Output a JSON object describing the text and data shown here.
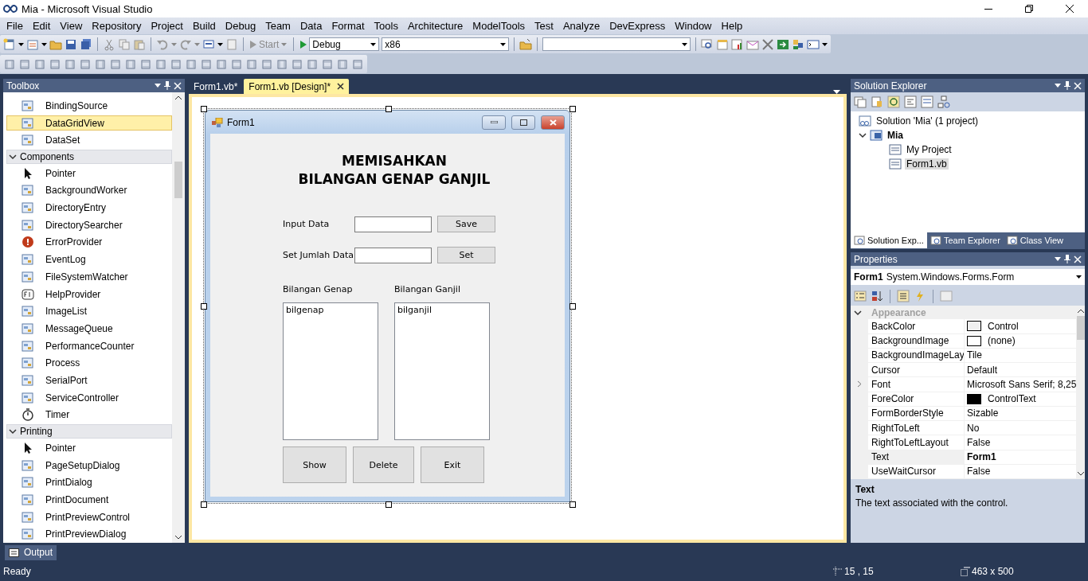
{
  "window": {
    "title": "Mia - Microsoft Visual Studio"
  },
  "menu": [
    "File",
    "Edit",
    "View",
    "Repository",
    "Project",
    "Build",
    "Debug",
    "Team",
    "Data",
    "Format",
    "Tools",
    "Architecture",
    "ModelTools",
    "Test",
    "Analyze",
    "DevExpress",
    "Window",
    "Help"
  ],
  "toolbar": {
    "start_label": "Start",
    "configuration": "Debug",
    "platform": "x86"
  },
  "toolbox": {
    "title": "Toolbox",
    "items": [
      {
        "kind": "item",
        "label": "BindingSource",
        "selected": false
      },
      {
        "kind": "item",
        "label": "DataGridView",
        "selected": true
      },
      {
        "kind": "item",
        "label": "DataSet",
        "selected": false
      },
      {
        "kind": "group",
        "label": "Components",
        "expanded": true
      },
      {
        "kind": "pointer",
        "label": "Pointer",
        "selected": false
      },
      {
        "kind": "item",
        "label": "BackgroundWorker",
        "selected": false
      },
      {
        "kind": "item",
        "label": "DirectoryEntry",
        "selected": false
      },
      {
        "kind": "item",
        "label": "DirectorySearcher",
        "selected": false
      },
      {
        "kind": "error",
        "label": "ErrorProvider",
        "selected": false
      },
      {
        "kind": "item",
        "label": "EventLog",
        "selected": false
      },
      {
        "kind": "item",
        "label": "FileSystemWatcher",
        "selected": false
      },
      {
        "kind": "help",
        "label": "HelpProvider",
        "selected": false
      },
      {
        "kind": "item",
        "label": "ImageList",
        "selected": false
      },
      {
        "kind": "item",
        "label": "MessageQueue",
        "selected": false
      },
      {
        "kind": "item",
        "label": "PerformanceCounter",
        "selected": false
      },
      {
        "kind": "item",
        "label": "Process",
        "selected": false
      },
      {
        "kind": "item",
        "label": "SerialPort",
        "selected": false
      },
      {
        "kind": "item",
        "label": "ServiceController",
        "selected": false
      },
      {
        "kind": "timer",
        "label": "Timer",
        "selected": false
      },
      {
        "kind": "group",
        "label": "Printing",
        "expanded": true
      },
      {
        "kind": "pointer",
        "label": "Pointer",
        "selected": false
      },
      {
        "kind": "item",
        "label": "PageSetupDialog",
        "selected": false
      },
      {
        "kind": "item",
        "label": "PrintDialog",
        "selected": false
      },
      {
        "kind": "item",
        "label": "PrintDocument",
        "selected": false
      },
      {
        "kind": "item",
        "label": "PrintPreviewControl",
        "selected": false
      },
      {
        "kind": "item",
        "label": "PrintPreviewDialog",
        "selected": false
      }
    ]
  },
  "document_tabs": [
    {
      "label": "Form1.vb*",
      "selected": false
    },
    {
      "label": "Form1.vb [Design]*",
      "selected": true
    }
  ],
  "designer": {
    "form": {
      "title": "Form1",
      "heading": "MEMISAHKAN\nBILANGAN GENAP GANJIL",
      "inputs": [
        {
          "label": "Input Data",
          "button": "Save"
        },
        {
          "label": "Set Jumlah Data",
          "button": "Set"
        }
      ],
      "lists": [
        {
          "label": "Bilangan Genap",
          "items": [
            "bilgenap"
          ]
        },
        {
          "label": "Bilangan Ganjil",
          "items": [
            "bilganjil"
          ]
        }
      ],
      "buttons": [
        "Show",
        "Delete",
        "Exit"
      ]
    }
  },
  "solution_explorer": {
    "title": "Solution Explorer",
    "tree": [
      {
        "label": "Solution 'Mia' (1 project)",
        "bold": false,
        "selected": false,
        "children": [
          {
            "label": "Mia",
            "bold": true,
            "selected": false,
            "expanded": true,
            "children": [
              {
                "label": "My Project",
                "bold": false,
                "selected": false
              },
              {
                "label": "Form1.vb",
                "bold": false,
                "selected": true
              }
            ]
          }
        ]
      }
    ],
    "tabs": [
      {
        "label": "Solution Exp...",
        "selected": true
      },
      {
        "label": "Team Explorer",
        "selected": false
      },
      {
        "label": "Class View",
        "selected": false
      }
    ]
  },
  "properties": {
    "title": "Properties",
    "object_name": "Form1",
    "object_type": "System.Windows.Forms.Form",
    "category": "Appearance",
    "rows": [
      {
        "name": "BackColor",
        "value": "Control",
        "color": "#f0f0f0",
        "selected": false,
        "bold": false,
        "expandable": false
      },
      {
        "name": "BackgroundImage",
        "value": "(none)",
        "color": "#ffffff",
        "selected": false,
        "bold": false,
        "expandable": false
      },
      {
        "name": "BackgroundImageLay",
        "value": "Tile",
        "selected": false,
        "bold": false,
        "expandable": false
      },
      {
        "name": "Cursor",
        "value": "Default",
        "selected": false,
        "bold": false,
        "expandable": false
      },
      {
        "name": "Font",
        "value": "Microsoft Sans Serif; 8,25",
        "selected": false,
        "bold": false,
        "expandable": true
      },
      {
        "name": "ForeColor",
        "value": "ControlText",
        "color": "#000000",
        "selected": false,
        "bold": false,
        "expandable": false
      },
      {
        "name": "FormBorderStyle",
        "value": "Sizable",
        "selected": false,
        "bold": false,
        "expandable": false
      },
      {
        "name": "RightToLeft",
        "value": "No",
        "selected": false,
        "bold": false,
        "expandable": false
      },
      {
        "name": "RightToLeftLayout",
        "value": "False",
        "selected": false,
        "bold": false,
        "expandable": false
      },
      {
        "name": "Text",
        "value": "Form1",
        "selected": true,
        "bold": true,
        "expandable": false
      },
      {
        "name": "UseWaitCursor",
        "value": "False",
        "selected": false,
        "bold": false,
        "expandable": false
      }
    ],
    "description": {
      "title": "Text",
      "text": "The text associated with the control."
    }
  },
  "output_tab": "Output",
  "status_bar": {
    "text": "Ready",
    "location": "15 , 15",
    "size": "463 x 500"
  }
}
